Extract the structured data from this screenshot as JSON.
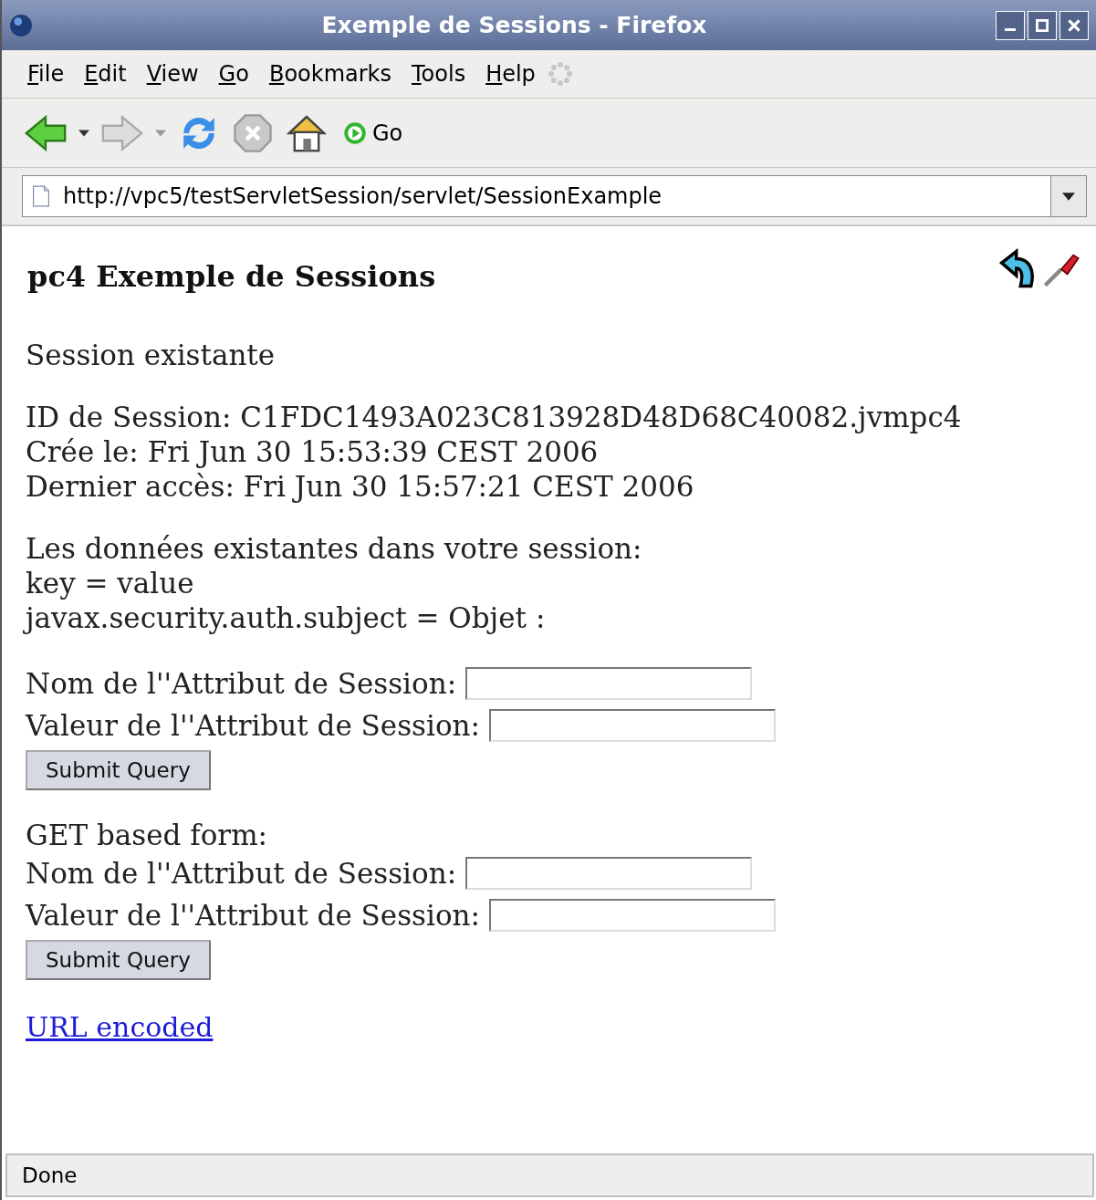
{
  "window": {
    "title": "Exemple de Sessions - Firefox"
  },
  "menu": [
    "File",
    "Edit",
    "View",
    "Go",
    "Bookmarks",
    "Tools",
    "Help"
  ],
  "toolbar": {
    "go_label": "Go"
  },
  "address_bar": {
    "url": "http://vpc5/testServletSession/servlet/SessionExample"
  },
  "page": {
    "heading": "pc4 Exemple de Sessions",
    "paragraphs": [
      [
        "Session existante"
      ],
      [
        "ID de Session: C1FDC1493A023C813928D48D68C40082.jvmpc4",
        "Crée le: Fri Jun 30 15:53:39 CEST 2006",
        "Dernier accès: Fri Jun 30 15:57:21 CEST 2006"
      ],
      [
        "Les données existantes dans votre session:",
        "key = value",
        "javax.security.auth.subject = Objet :"
      ]
    ],
    "forms": [
      {
        "fields": [
          {
            "label": "Nom de l''Attribut de Session:"
          },
          {
            "label": "Valeur de l''Attribut de Session:"
          }
        ],
        "submit": "Submit Query"
      },
      {
        "caption": "GET based form:",
        "fields": [
          {
            "label": "Nom de l''Attribut de Session:"
          },
          {
            "label": "Valeur de l''Attribut de Session:"
          }
        ],
        "submit": "Submit Query"
      }
    ],
    "link": "URL encoded"
  },
  "status_bar": {
    "text": "Done"
  }
}
